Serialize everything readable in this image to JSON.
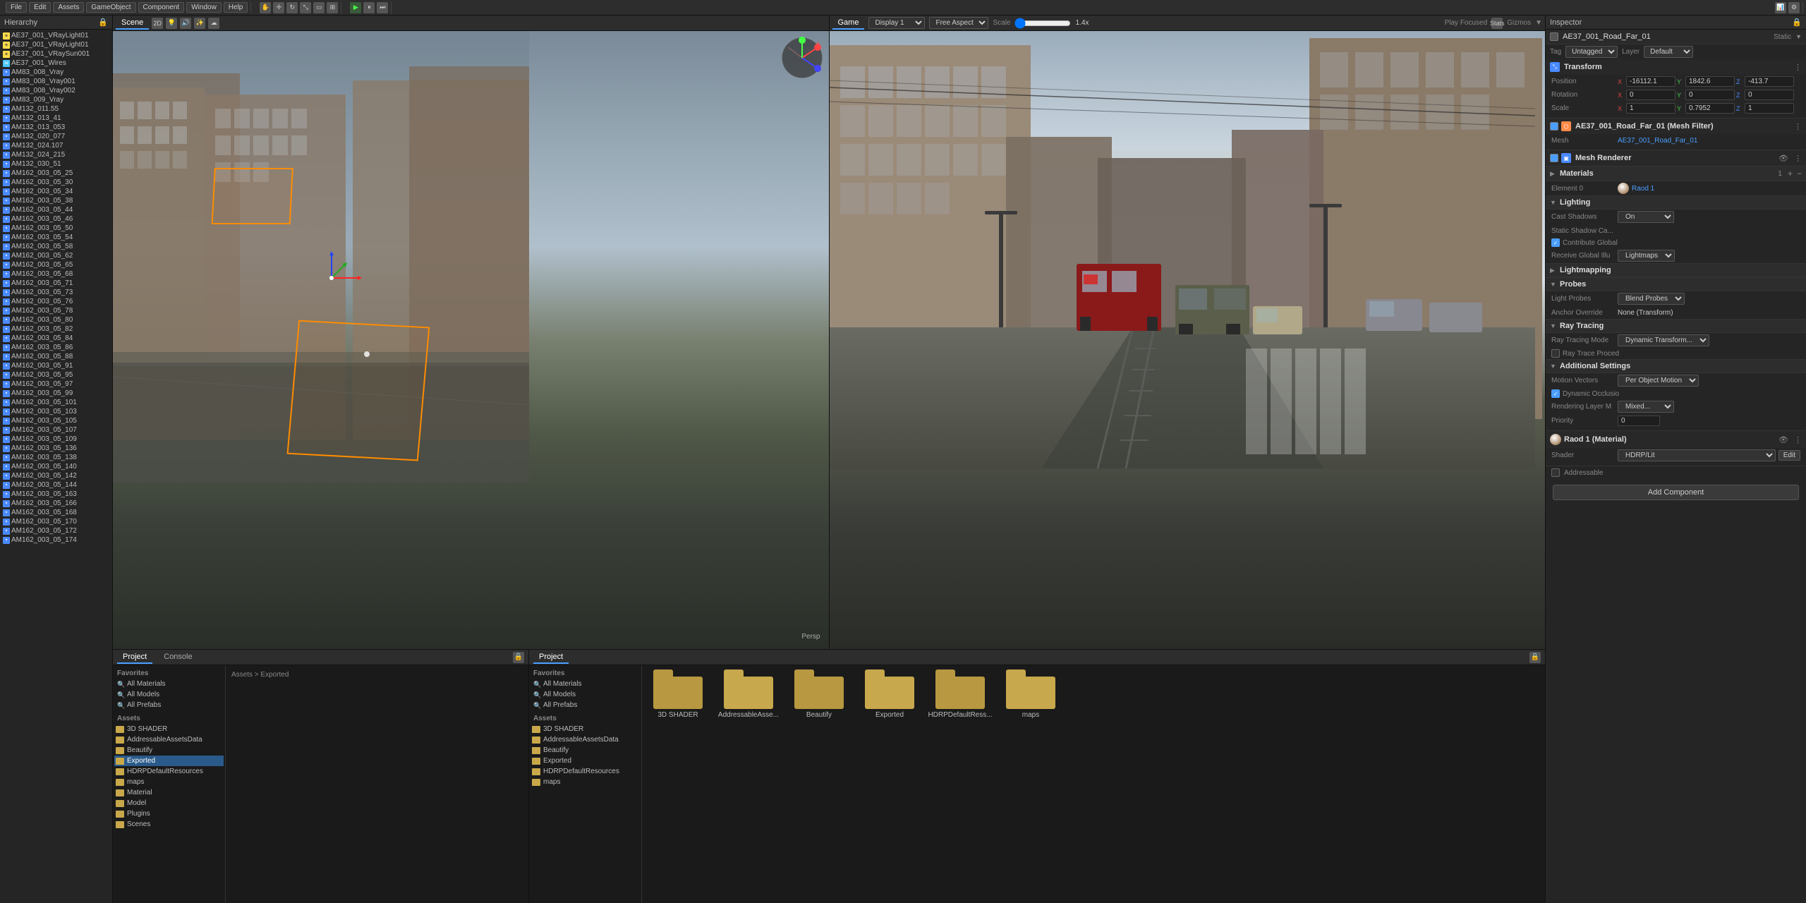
{
  "topbar": {
    "menus": [
      "File",
      "Edit",
      "Assets",
      "GameObject",
      "Component",
      "Window",
      "Help"
    ]
  },
  "hierarchy": {
    "title": "Hierarchy",
    "items": [
      "AE37_001_VRayLight01",
      "AE37_001_VRayLight01",
      "AE37_001_VRaySun001",
      "AE37_001_Wires",
      "AM83_008_Vray",
      "AM83_008_Vray001",
      "AM83_008_Vray002",
      "AM83_009_Vray",
      "AM132_011.55",
      "AM132_013_41",
      "AM132_013_053",
      "AM132_020_077",
      "AM132_024.107",
      "AM132_024_215",
      "AM132_030_51",
      "AM162_003_05_25",
      "AM162_003_05_30",
      "AM162_003_05_34",
      "AM162_003_05_38",
      "AM162_003_05_44",
      "AM162_003_05_46",
      "AM162_003_05_50",
      "AM162_003_05_54",
      "AM162_003_05_58",
      "AM162_003_05_62",
      "AM162_003_05_65",
      "AM162_003_05_68",
      "AM162_003_05_71",
      "AM162_003_05_73",
      "AM162_003_05_76",
      "AM162_003_05_78",
      "AM162_003_05_80",
      "AM162_003_05_82",
      "AM162_003_05_84",
      "AM162_003_05_86",
      "AM162_003_05_88",
      "AM162_003_05_91",
      "AM162_003_05_95",
      "AM162_003_05_97",
      "AM162_003_05_99",
      "AM162_003_05_101",
      "AM162_003_05_103",
      "AM162_003_05_105",
      "AM162_003_05_107",
      "AM162_003_05_109",
      "AM162_003_05_136",
      "AM162_003_05_138",
      "AM162_003_05_140",
      "AM162_003_05_142",
      "AM162_003_05_144",
      "AM162_003_05_163",
      "AM162_003_05_166",
      "AM162_003_05_168",
      "AM162_003_05_170",
      "AM162_003_05_172",
      "AM162_003_05_174"
    ]
  },
  "scene": {
    "title": "Scene",
    "persp_label": "Persp"
  },
  "game": {
    "title": "Game",
    "display": "Display 1",
    "aspect": "Free Aspect",
    "scale_label": "Scale",
    "scale_value": "1.4x"
  },
  "inspector": {
    "title": "Inspector",
    "object_name": "AE37_001_Road_Far_01",
    "static_label": "Static",
    "tag_label": "Tag",
    "tag_value": "Untagged",
    "layer_label": "Layer",
    "layer_value": "Default",
    "transform": {
      "title": "Transform",
      "position": {
        "label": "Position",
        "x": "-16112.1",
        "y": "1842.6",
        "z": "-413.7"
      },
      "rotation": {
        "label": "Rotation",
        "x": "0",
        "y": "0",
        "z": "0"
      },
      "scale": {
        "label": "Scale",
        "x": "1",
        "y": "0.7952",
        "z": "1"
      }
    },
    "mesh_filter": {
      "title": "AE37_001_Road_Far_01 (Mesh Filter)",
      "mesh_label": "Mesh",
      "mesh_value": "AE37_001_Road_Far_01"
    },
    "mesh_renderer": {
      "title": "Mesh Renderer",
      "materials_label": "Materials",
      "materials_count": "1",
      "element0_label": "Element 0",
      "element0_value": "Raod 1"
    },
    "lighting": {
      "title": "Lighting",
      "cast_shadows_label": "Cast Shadows",
      "cast_shadows_value": "On",
      "static_shadow_label": "Static Shadow Ca...",
      "contribute_global_label": "Contribute Global",
      "receive_gi_label": "Receive Global Illu",
      "receive_gi_value": "Lightmaps"
    },
    "lightmapping": {
      "title": "Lightmapping"
    },
    "probes": {
      "title": "Probes",
      "light_probes_label": "Light Probes",
      "light_probes_value": "Blend Probes",
      "anchor_override_label": "Anchor Override",
      "anchor_override_value": "None (Transform)"
    },
    "ray_tracing": {
      "title": "Ray Tracing",
      "mode_label": "Ray Tracing Mode",
      "mode_value": "Dynamic Transform...",
      "probe_label": "Ray Trace Proced"
    },
    "additional_settings": {
      "title": "Additional Settings",
      "motion_vectors_label": "Motion Vectors",
      "motion_vectors_value": "Per Object Motion",
      "dynamic_occlusion_label": "Dynamic Occlusio",
      "rendering_layer_label": "Rendering Layer M",
      "rendering_layer_value": "Mixed...",
      "priority_label": "Priority",
      "priority_value": "0"
    },
    "material": {
      "title": "Raod 1 (Material)",
      "shader_label": "Shader",
      "shader_value": "HDRP/Lit",
      "edit_label": "Edit"
    },
    "addressable": {
      "label": "Addressable"
    },
    "add_component_label": "Add Component"
  },
  "console": {
    "tab_project_label": "Project",
    "tab_console_label": "Console"
  },
  "project_panel1": {
    "title": "Project",
    "favorites": {
      "title": "Favorites",
      "items": [
        "All Materials",
        "All Models",
        "All Prefabs"
      ]
    },
    "assets": {
      "title": "Assets",
      "items": [
        "3D SHADER",
        "AddressableAssetsData",
        "Beautify",
        "Exported",
        "HDRPDefaultResources",
        "maps",
        "Material",
        "Model",
        "Plugins",
        "Scenes"
      ]
    }
  },
  "project_panel2": {
    "title": "Project",
    "favorites": {
      "items": [
        "All Materials",
        "All Models",
        "All Prefabs"
      ]
    },
    "assets": {
      "title": "Assets",
      "items": [
        "3D SHADER",
        "AddressableAssetsData",
        "Beautify",
        "Exported",
        "HDRPDefaultResources",
        "maps"
      ]
    },
    "asset_folders": [
      "3D SHADER",
      "AddressableAsse...",
      "Beautify",
      "Exported",
      "HDRPDefaultRess...",
      "maps"
    ]
  }
}
